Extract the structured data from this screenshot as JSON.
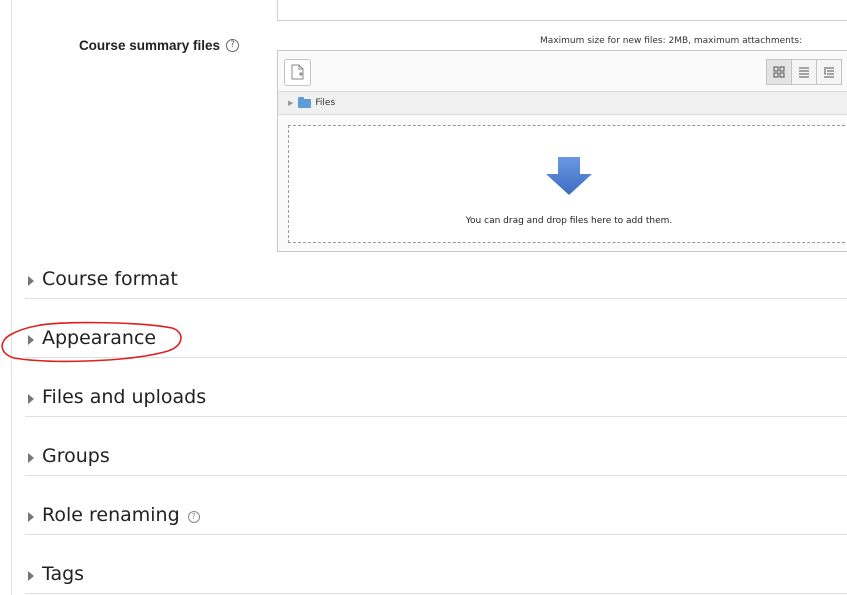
{
  "course_summary_files": {
    "label": "Course summary files",
    "help_icon": "?",
    "max_size_text": "Maximum size for new files: 2MB, maximum attachments:",
    "path_root": "Files",
    "drop_text": "You can drag and drop files here to add them.",
    "icons": [
      "add-file-icon",
      "icons-view-icon",
      "list-view-icon",
      "tree-view-icon",
      "folder-icon",
      "download-arrow-icon"
    ]
  },
  "sections": [
    {
      "title": "Course format",
      "help": ""
    },
    {
      "title": "Appearance",
      "help": ""
    },
    {
      "title": "Files and uploads",
      "help": ""
    },
    {
      "title": "Groups",
      "help": ""
    },
    {
      "title": "Role renaming",
      "help": "?"
    },
    {
      "title": "Tags",
      "help": ""
    }
  ],
  "colors": {
    "annotation": "#e02020",
    "folder": "#5d9cd8",
    "drop_arrow": "#4f7fd4"
  }
}
